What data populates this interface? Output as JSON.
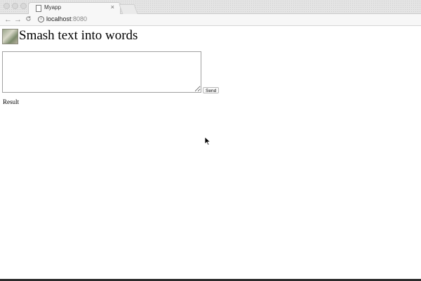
{
  "browser": {
    "tab_title": "Myapp",
    "tab_close": "×",
    "back": "←",
    "forward": "→",
    "reload": "C",
    "info": "i",
    "url_host": "localhost",
    "url_port": ":8080"
  },
  "page": {
    "title": "Smash text into words",
    "textarea_value": "",
    "send_label": "Send",
    "result_label": "Result"
  }
}
